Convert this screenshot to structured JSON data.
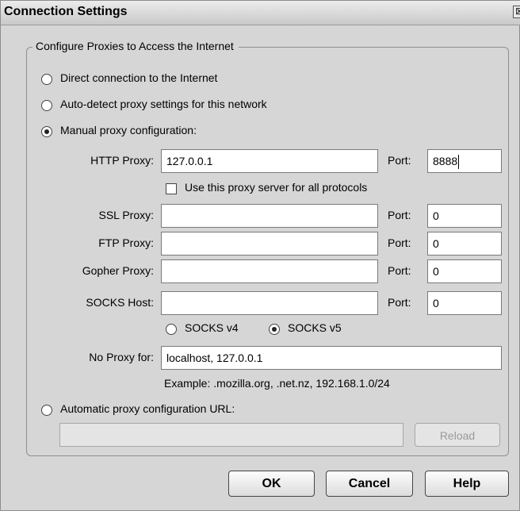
{
  "window": {
    "title": "Connection Settings",
    "close_glyph": "⊠"
  },
  "group": {
    "legend": "Configure Proxies to Access the Internet"
  },
  "options": {
    "direct": "Direct connection to the Internet",
    "autodetect": "Auto-detect proxy settings for this network",
    "manual": "Manual proxy configuration:",
    "auto_url": "Automatic proxy configuration URL:"
  },
  "manual": {
    "http": {
      "label": "HTTP Proxy:",
      "value": "127.0.0.1",
      "port_label": "Port:",
      "port": "8888"
    },
    "use_all": {
      "label": "Use this proxy server for all protocols",
      "checked": false
    },
    "ssl": {
      "label": "SSL Proxy:",
      "value": "",
      "port_label": "Port:",
      "port": "0"
    },
    "ftp": {
      "label": "FTP Proxy:",
      "value": "",
      "port_label": "Port:",
      "port": "0"
    },
    "gopher": {
      "label": "Gopher Proxy:",
      "value": "",
      "port_label": "Port:",
      "port": "0"
    },
    "socks": {
      "label": "SOCKS Host:",
      "value": "",
      "port_label": "Port:",
      "port": "0"
    },
    "socks_v4": "SOCKS v4",
    "socks_v5": "SOCKS v5",
    "no_proxy": {
      "label": "No Proxy for:",
      "value": "localhost, 127.0.0.1"
    },
    "example": "Example: .mozilla.org, .net.nz, 192.168.1.0/24"
  },
  "auto": {
    "url_value": "",
    "reload_label": "Reload"
  },
  "buttons": {
    "ok": "OK",
    "cancel": "Cancel",
    "help": "Help"
  },
  "selected": {
    "mode": "manual",
    "socks_version": "v5"
  },
  "colors": {
    "dialog_bg": "#d6d6d6",
    "field_bg": "#ffffff",
    "disabled_bg": "#e4e4e4"
  }
}
